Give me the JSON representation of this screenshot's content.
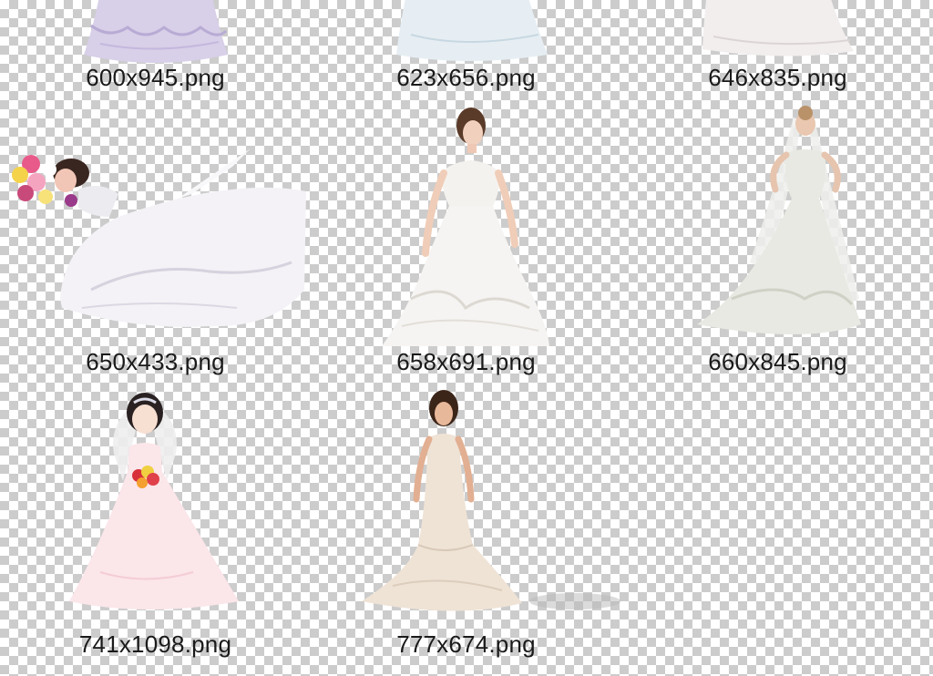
{
  "files": [
    {
      "name": "600x945.png",
      "icon": "wedding-dress-thumbnail",
      "dress_color": "#d8cfe8"
    },
    {
      "name": "623x656.png",
      "icon": "wedding-dress-thumbnail",
      "dress_color": "#e6eef3"
    },
    {
      "name": "646x835.png",
      "icon": "wedding-dress-thumbnail",
      "dress_color": "#f2eeee"
    },
    {
      "name": "650x433.png",
      "icon": "reclining-bride-thumbnail",
      "dress_color": "#f4f2f6"
    },
    {
      "name": "658x691.png",
      "icon": "bride-thumbnail",
      "dress_color": "#f6f4f2"
    },
    {
      "name": "660x845.png",
      "icon": "bride-veil-thumbnail",
      "dress_color": "#e8e9e2"
    },
    {
      "name": "741x1098.png",
      "icon": "cartoon-bride-thumbnail",
      "dress_color": "#fbe6ea"
    },
    {
      "name": "777x674.png",
      "icon": "mermaid-bride-thumbnail",
      "dress_color": "#efe3d6"
    }
  ]
}
